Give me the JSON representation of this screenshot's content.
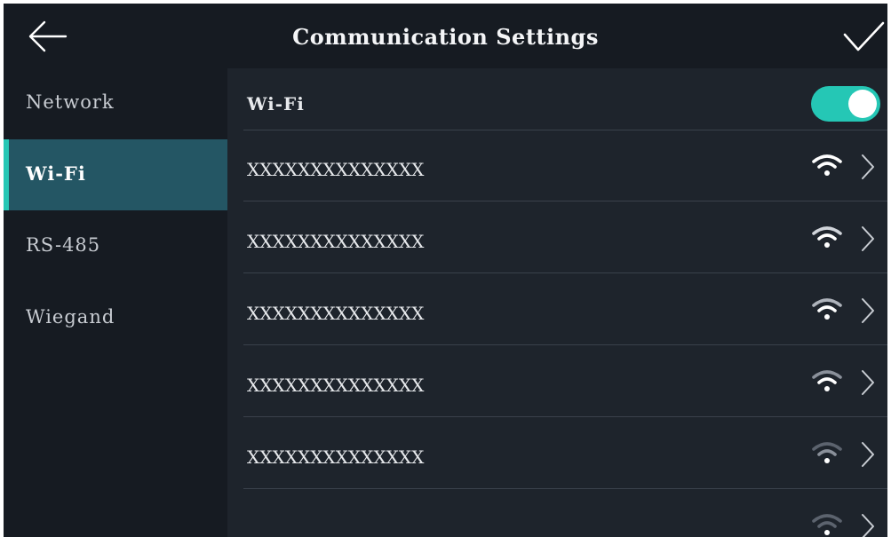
{
  "header": {
    "title": "Communication Settings",
    "back_icon": "arrow-left-icon",
    "confirm_icon": "checkmark-icon"
  },
  "sidebar": {
    "items": [
      {
        "label": "Network",
        "active": false
      },
      {
        "label": "Wi-Fi",
        "active": true
      },
      {
        "label": "RS-485",
        "active": false
      },
      {
        "label": "Wiegand",
        "active": false
      }
    ]
  },
  "wifi": {
    "toggle_label": "Wi-Fi",
    "enabled": true,
    "networks": [
      {
        "ssid": "XXXXXXXXXXXXXX",
        "signal_icon": "wifi-strong-icon"
      },
      {
        "ssid": "XXXXXXXXXXXXXX",
        "signal_icon": "wifi-icon"
      },
      {
        "ssid": "XXXXXXXXXXXXXX",
        "signal_icon": "wifi-icon"
      },
      {
        "ssid": "XXXXXXXXXXXXXX",
        "signal_icon": "wifi-icon"
      },
      {
        "ssid": "XXXXXXXXXXXXXX",
        "signal_icon": "wifi-weak-icon"
      },
      {
        "ssid": "",
        "signal_icon": "wifi-weak-icon"
      }
    ]
  },
  "colors": {
    "accent": "#25c7b5",
    "active_item_bg": "#245664",
    "header_bg": "#161b22",
    "content_bg": "#1e242c",
    "divider": "#3a414b"
  }
}
